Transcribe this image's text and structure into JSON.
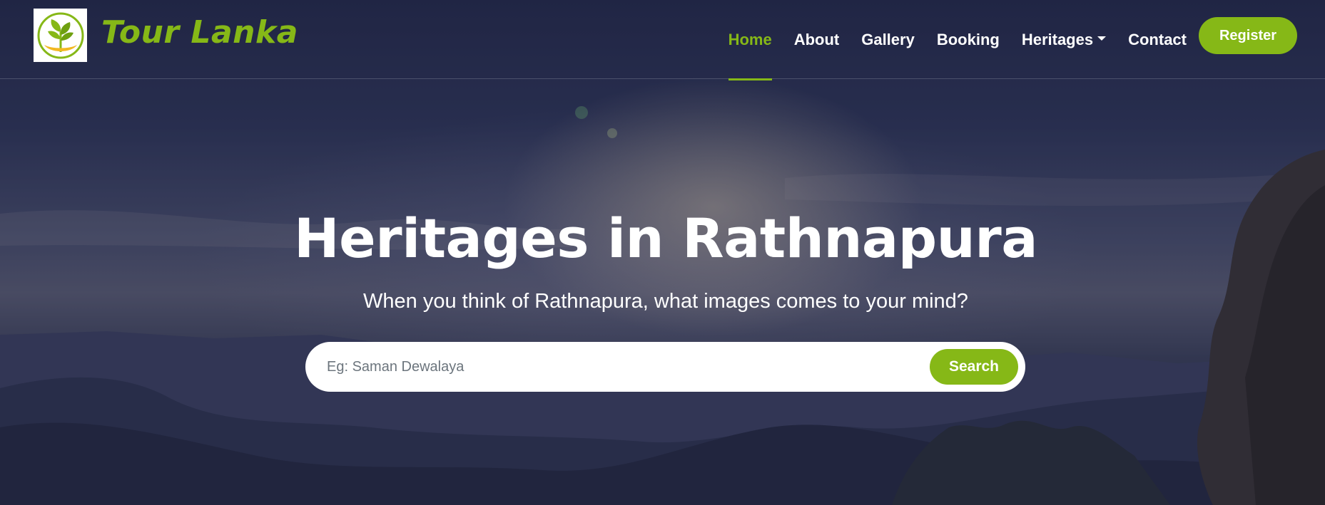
{
  "brand": {
    "name": "Tour Lanka",
    "logo_icon": "leaf-sprout-icon"
  },
  "nav": {
    "items": [
      {
        "label": "Home",
        "active": true
      },
      {
        "label": "About"
      },
      {
        "label": "Gallery"
      },
      {
        "label": "Booking"
      },
      {
        "label": "Heritages",
        "dropdown": true
      },
      {
        "label": "Contact"
      }
    ],
    "register_label": "Register"
  },
  "hero": {
    "title": "Heritages in Rathnapura",
    "subtitle": "When you think of Rathnapura, what images comes to your mind?",
    "search_placeholder": "Eg: Saman Dewalaya",
    "search_value": "",
    "search_button_label": "Search",
    "background_icon": "mountain-sunrise-image"
  },
  "colors": {
    "accent": "#86b817",
    "text_light": "#ffffff",
    "placeholder": "#6c757d",
    "sky_dark": "#252a4a"
  }
}
